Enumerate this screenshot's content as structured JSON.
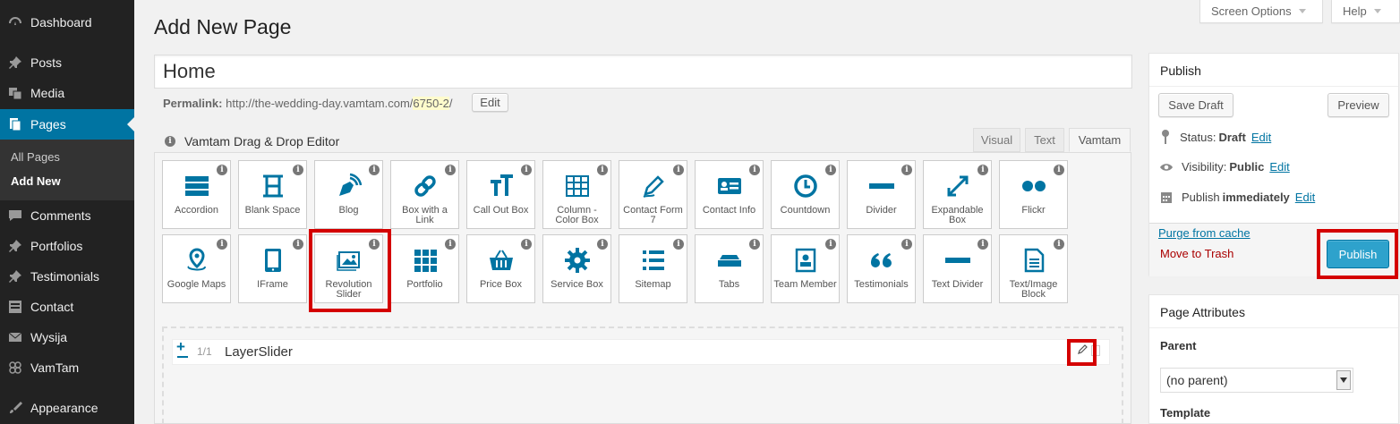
{
  "menu": {
    "items": [
      {
        "label": "Dashboard",
        "icon": "dashboard-icon"
      },
      {
        "label": "Posts",
        "icon": "pin-icon"
      },
      {
        "label": "Media",
        "icon": "media-icon"
      },
      {
        "label": "Pages",
        "icon": "pages-icon"
      },
      {
        "label": "Comments",
        "icon": "comment-icon"
      },
      {
        "label": "Portfolios",
        "icon": "pin-icon"
      },
      {
        "label": "Testimonials",
        "icon": "pin-icon"
      },
      {
        "label": "Contact",
        "icon": "contact-icon"
      },
      {
        "label": "Wysija",
        "icon": "mail-icon"
      },
      {
        "label": "VamTam",
        "icon": "vamtam-icon"
      },
      {
        "label": "Appearance",
        "icon": "brush-icon"
      }
    ],
    "submenu": {
      "all": "All Pages",
      "add": "Add New"
    }
  },
  "screen_options": "Screen Options",
  "help": "Help",
  "page_heading": "Add New Page",
  "title_value": "Home",
  "permalink": {
    "label": "Permalink:",
    "base": "http://the-wedding-day.vamtam.com/",
    "slug": "6750-2",
    "tail": "/",
    "edit": "Edit"
  },
  "editor": {
    "title": "Vamtam Drag & Drop Editor",
    "tabs": [
      "Visual",
      "Text",
      "Vamtam"
    ],
    "elements_row1": [
      "Accordion",
      "Blank Space",
      "Blog",
      "Box with a Link",
      "Call Out Box",
      "Column - Color Box",
      "Contact Form 7",
      "Contact Info",
      "Countdown",
      "Divider",
      "Expandable Box",
      "Flickr"
    ],
    "elements_row2": [
      "Google Maps",
      "IFrame",
      "Revolution Slider",
      "Portfolio",
      "Price Box",
      "Service Box",
      "Sitemap",
      "Tabs",
      "Team Member",
      "Testimonials",
      "Text Divider",
      "Text/Image Block"
    ],
    "row": {
      "size": "1/1",
      "name": "LayerSlider"
    }
  },
  "publish": {
    "title": "Publish",
    "save_draft": "Save Draft",
    "preview": "Preview",
    "status_label": "Status:",
    "status_value": "Draft",
    "visibility_label": "Visibility:",
    "visibility_value": "Public",
    "publish_label": "Publish",
    "publish_value": "immediately",
    "edit": "Edit",
    "purge": "Purge from cache",
    "trash": "Move to Trash",
    "button": "Publish"
  },
  "attributes": {
    "title": "Page Attributes",
    "parent_label": "Parent",
    "parent_value": "(no parent)",
    "template_label": "Template"
  },
  "colors": {
    "accent": "#0074a2",
    "highlight": "#d40000",
    "icon": "#0074a2"
  }
}
